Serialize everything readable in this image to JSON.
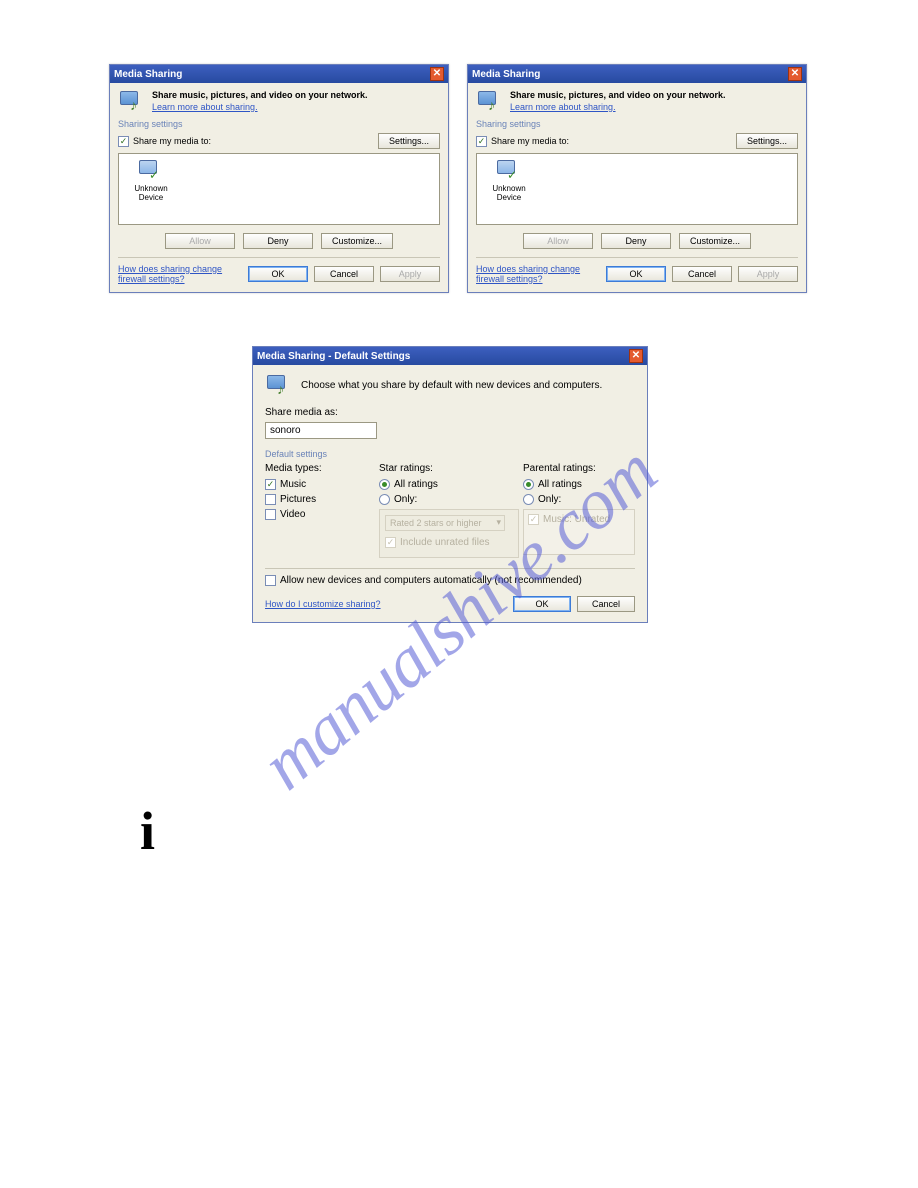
{
  "dlg1": {
    "title": "Media Sharing",
    "desc": "Share music, pictures, and video on your network.",
    "learn": "Learn more about sharing.",
    "section": "Sharing settings",
    "share_chk": "Share my media to:",
    "settings_btn": "Settings...",
    "device": "Unknown Device",
    "allow_btn": "Allow",
    "deny_btn": "Deny",
    "customize_btn": "Customize...",
    "link": "How does sharing change firewall settings?",
    "ok": "OK",
    "cancel": "Cancel",
    "apply": "Apply"
  },
  "dlg3": {
    "title": "Media Sharing - Default Settings",
    "intro": "Choose what you share by default with new devices and computers.",
    "share_as": "Share media as:",
    "share_as_value": "sonoro",
    "default": "Default settings",
    "types": "Media types:",
    "type_music": "Music",
    "type_pictures": "Pictures",
    "type_video": "Video",
    "star": "Star ratings:",
    "all_ratings": "All ratings",
    "only": "Only:",
    "rated_combo": "Rated 2 stars or higher",
    "include": "Include unrated files",
    "parental": "Parental ratings:",
    "parental_item": "Music: Unrated",
    "allow_new": "Allow new devices and computers automatically (not recommended)",
    "custom_link": "How do I customize sharing?",
    "ok": "OK",
    "cancel": "Cancel"
  },
  "watermark": "manualshive.com",
  "info": "i"
}
